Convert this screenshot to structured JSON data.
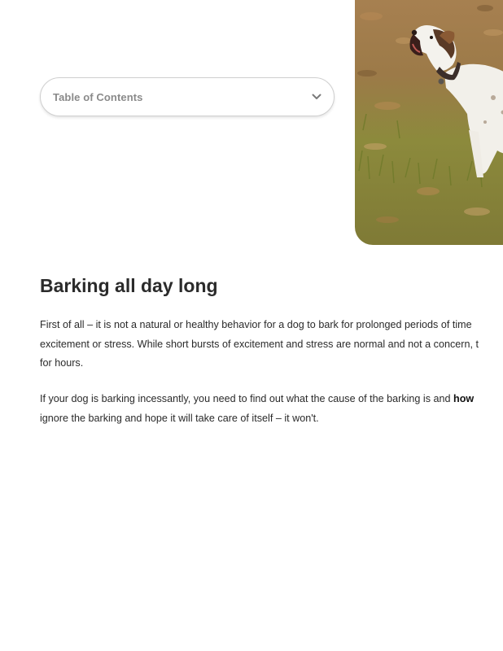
{
  "toc": {
    "label": "Table of Contents",
    "icon": "chevron-down-icon"
  },
  "hero_image": {
    "alt": "",
    "colors": {
      "grass": "#8d8a3a",
      "ground": "#a77b47",
      "dog_body": "#f3f1ec",
      "dog_patch": "#4a2f22",
      "collar": "#3b2e2a"
    }
  },
  "article": {
    "heading": "Barking all day long",
    "paragraph1": {
      "lines": [
        "First of all – it is not a natural or healthy behavior for a dog to bark for prolonged periods of time",
        "excitement or stress. While short bursts of excitement and stress are normal and not a concern, t",
        "for hours."
      ]
    },
    "paragraph2": {
      "line1_text": "If your dog is barking incessantly, you need to find out what the cause of the barking is and ",
      "line1_bold": "how",
      "line2": "ignore the barking and hope it will take care of itself – it won't."
    }
  }
}
